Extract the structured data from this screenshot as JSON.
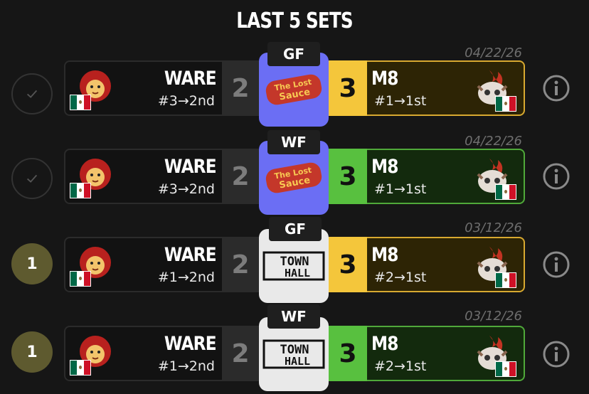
{
  "header": {
    "title": "LAST 5 SETS"
  },
  "sets": [
    {
      "round": "GF",
      "date": "04/22/26",
      "status": {
        "type": "check",
        "value": ""
      },
      "player1": {
        "name": "WARE",
        "seed": "#3→2nd",
        "score": "2"
      },
      "player2": {
        "name": "M8",
        "seed": "#1→1st",
        "score": "3",
        "color": "#f4c63b"
      },
      "event_logo": "the-lost-sauce-logo",
      "event_logo_text": [
        "The Lost",
        "Sauce"
      ]
    },
    {
      "round": "WF",
      "date": "04/22/26",
      "status": {
        "type": "check",
        "value": ""
      },
      "player1": {
        "name": "WARE",
        "seed": "#3→2nd",
        "score": "2"
      },
      "player2": {
        "name": "M8",
        "seed": "#1→1st",
        "score": "3",
        "color": "#58c03f"
      },
      "event_logo": "the-lost-sauce-logo",
      "event_logo_text": [
        "The Lost",
        "Sauce"
      ]
    },
    {
      "round": "GF",
      "date": "03/12/26",
      "status": {
        "type": "count",
        "value": "1"
      },
      "player1": {
        "name": "WARE",
        "seed": "#1→2nd",
        "score": "2"
      },
      "player2": {
        "name": "M8",
        "seed": "#2→1st",
        "score": "3",
        "color": "#f4c63b"
      },
      "event_logo": "town-hall-logo",
      "event_logo_text": [
        "TOWN",
        "HALL"
      ]
    },
    {
      "round": "WF",
      "date": "03/12/26",
      "status": {
        "type": "count",
        "value": "1"
      },
      "player1": {
        "name": "WARE",
        "seed": "#1→2nd",
        "score": "2"
      },
      "player2": {
        "name": "M8",
        "seed": "#2→1st",
        "score": "3",
        "color": "#58c03f"
      },
      "event_logo": "town-hall-logo",
      "event_logo_text": [
        "TOWN",
        "HALL"
      ]
    }
  ],
  "colors": {
    "background": "#161616",
    "winner_gold": "#f4c63b",
    "winner_green": "#58c03f",
    "sauce_logo_bg": "#6b6ef4",
    "townhall_logo_bg": "#e9e9e9"
  }
}
